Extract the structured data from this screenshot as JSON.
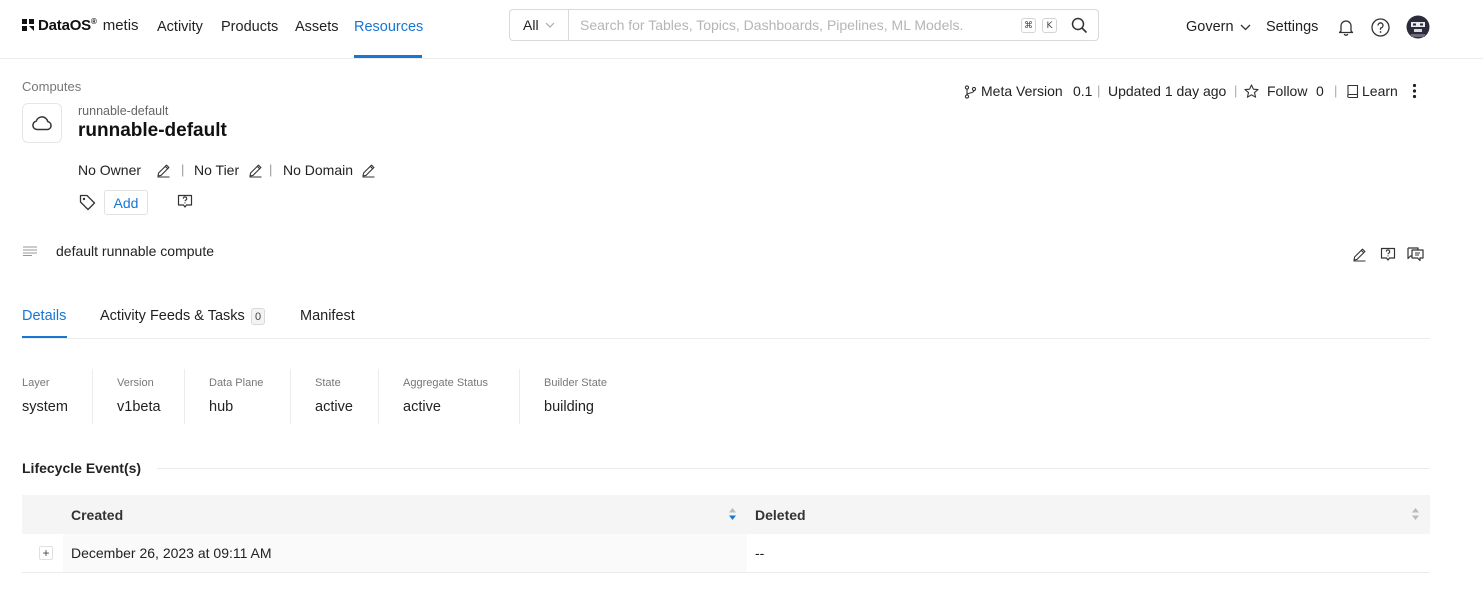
{
  "nav": {
    "logo_text": "DataOS",
    "logo_sup": "®",
    "logo_sub": "metis",
    "items": [
      {
        "label": "Activity"
      },
      {
        "label": "Products"
      },
      {
        "label": "Assets"
      },
      {
        "label": "Resources",
        "active": true
      }
    ],
    "search": {
      "scope": "All",
      "placeholder": "Search for Tables, Topics, Dashboards, Pipelines, ML Models.",
      "shortcut_cmd": "⌘",
      "shortcut_key": "K"
    },
    "govern_label": "Govern",
    "settings_label": "Settings"
  },
  "entity": {
    "breadcrumb": "Computes",
    "icon": "cloud-icon",
    "subtitle": "runnable-default",
    "title": "runnable-default",
    "owner": "No Owner",
    "tier": "No Tier",
    "domain": "No Domain",
    "add_tag_label": "Add",
    "description": "default runnable compute"
  },
  "header_meta": {
    "meta_version_label": "Meta Version",
    "meta_version_value": "0.1",
    "updated": "Updated 1 day ago",
    "follow_label": "Follow",
    "follow_count": "0",
    "learn_label": "Learn"
  },
  "tabs": [
    {
      "label": "Details",
      "active": true
    },
    {
      "label": "Activity Feeds & Tasks",
      "count": "0"
    },
    {
      "label": "Manifest"
    }
  ],
  "properties": [
    {
      "label": "Layer",
      "value": "system"
    },
    {
      "label": "Version",
      "value": "v1beta"
    },
    {
      "label": "Data Plane",
      "value": "hub"
    },
    {
      "label": "State",
      "value": "active"
    },
    {
      "label": "Aggregate Status",
      "value": "active"
    },
    {
      "label": "Builder State",
      "value": "building"
    }
  ],
  "lifecycle": {
    "title": "Lifecycle Event(s)",
    "columns": [
      "Created",
      "Deleted"
    ],
    "rows": [
      {
        "created": "December 26, 2023 at 09:11 AM",
        "deleted": "--"
      }
    ]
  },
  "colors": {
    "accent": "#1677d2",
    "border": "#ececec",
    "muted_text": "#777777"
  }
}
